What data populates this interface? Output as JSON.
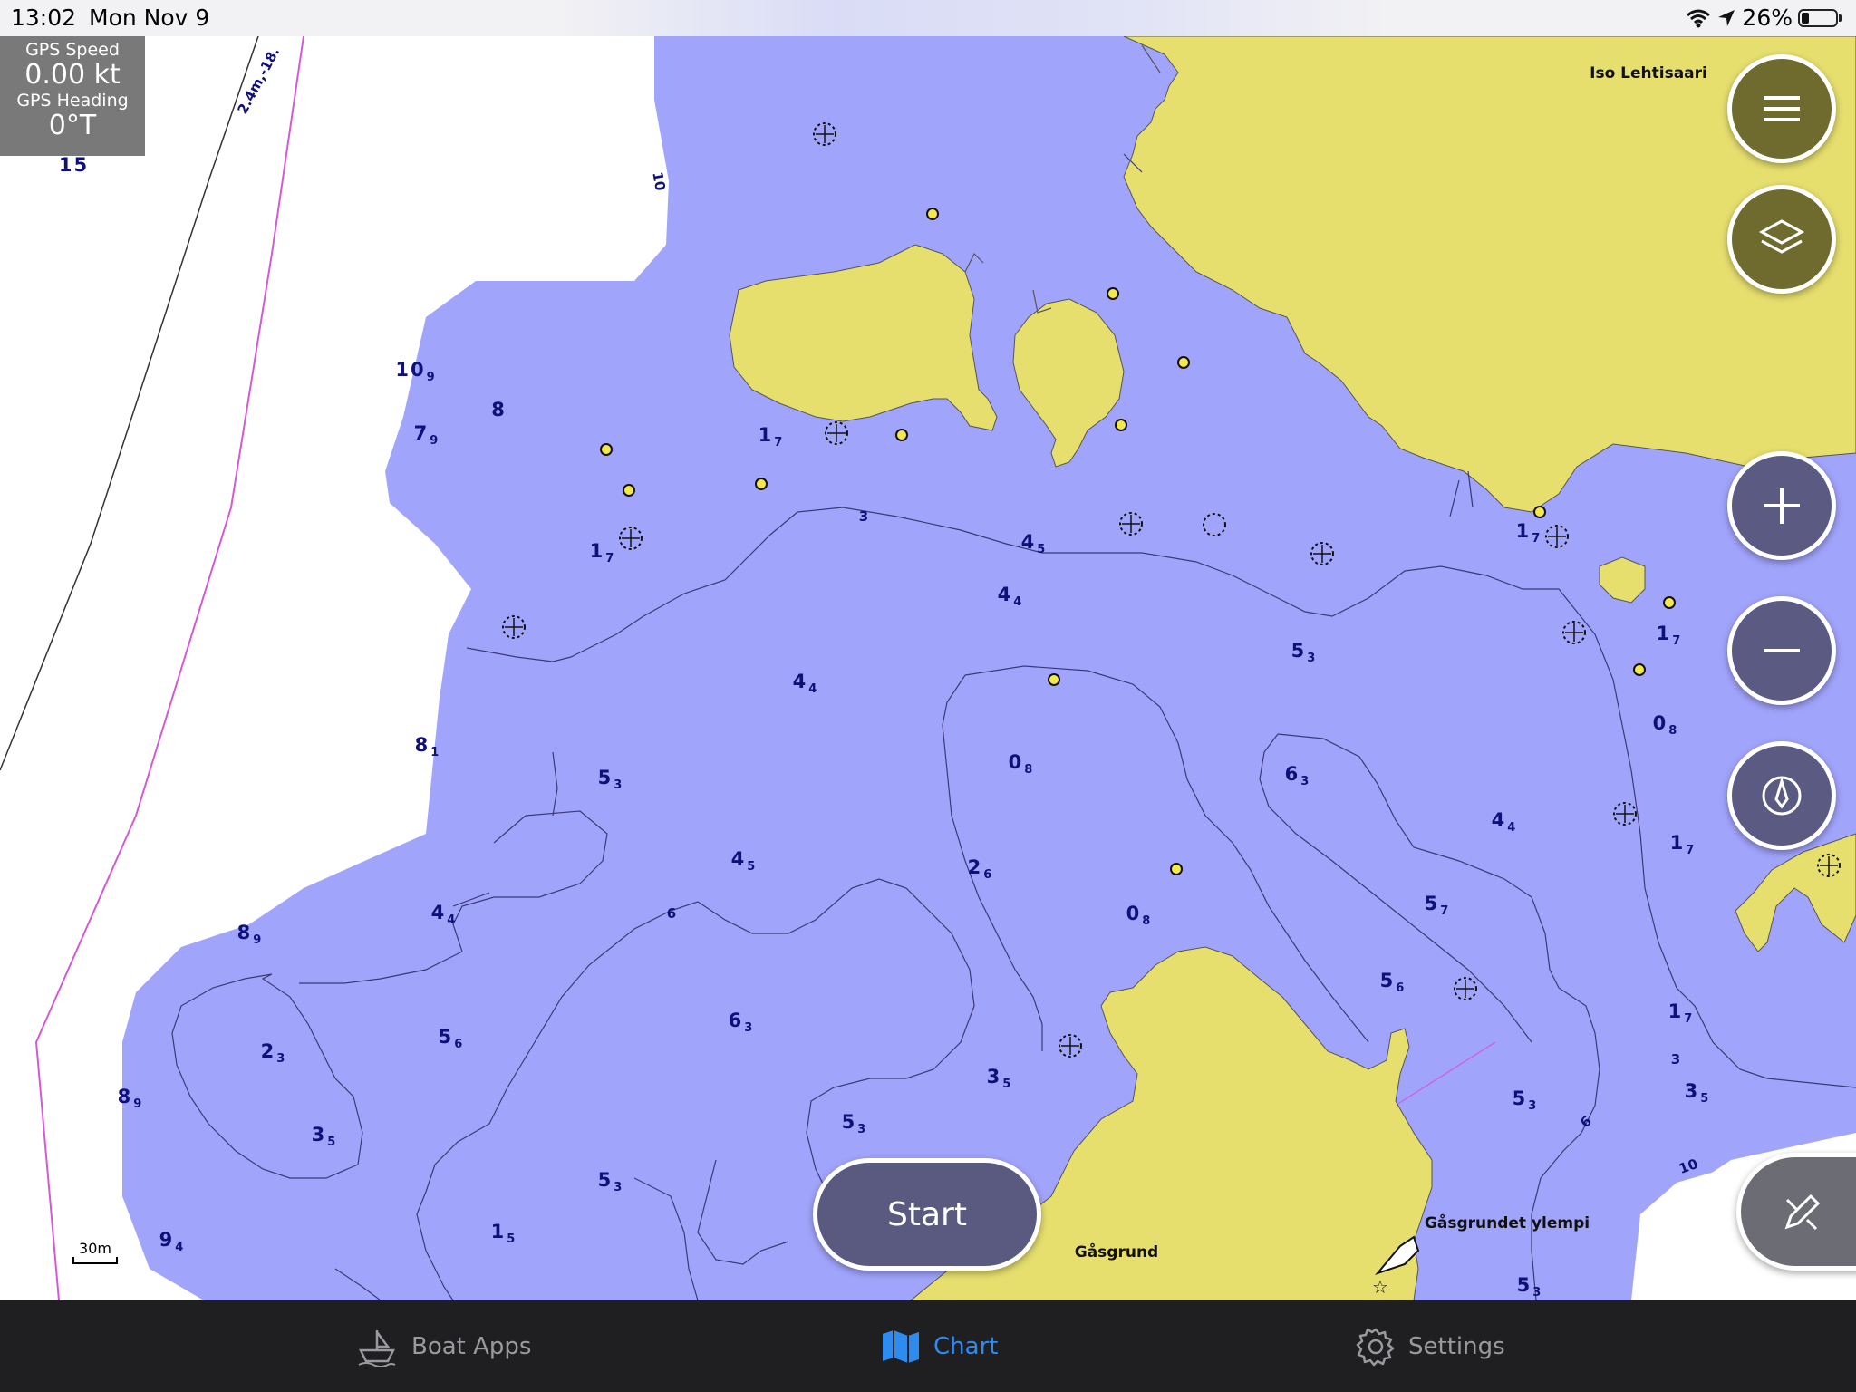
{
  "status_bar": {
    "time": "13:02",
    "date": "Mon Nov 9",
    "battery": "26%",
    "icons": [
      "wifi-icon",
      "location-arrow-icon",
      "battery-icon"
    ]
  },
  "gps_panel": {
    "speed_label": "GPS Speed",
    "speed_value": "0.00 kt",
    "heading_label": "GPS Heading",
    "heading_value": "0°T"
  },
  "map": {
    "colors": {
      "land": "#e6df6e",
      "water": "#a1a4fb",
      "deep_water": "#ffffff",
      "depth_text": "#10107a",
      "safety_line": "#d45ad4"
    },
    "places": [
      "Iso Lehtisaari",
      "Gåsgrund",
      "Gåsgrundet ylempi"
    ],
    "route_label": "2.4m,-18.",
    "contour_labels": [
      "10",
      "3",
      "6",
      "3",
      "6",
      "10"
    ],
    "soundings": [
      {
        "main": "15",
        "sub": ""
      },
      {
        "main": "10",
        "sub": "9"
      },
      {
        "main": "8",
        "sub": ""
      },
      {
        "main": "7",
        "sub": "9"
      },
      {
        "main": "1",
        "sub": "7"
      },
      {
        "main": "1",
        "sub": "7"
      },
      {
        "main": "4",
        "sub": "5"
      },
      {
        "main": "4",
        "sub": "4"
      },
      {
        "main": "4",
        "sub": "4"
      },
      {
        "main": "5",
        "sub": "3"
      },
      {
        "main": "1",
        "sub": "7"
      },
      {
        "main": "1",
        "sub": "7"
      },
      {
        "main": "0",
        "sub": "8"
      },
      {
        "main": "8",
        "sub": "1"
      },
      {
        "main": "5",
        "sub": "3"
      },
      {
        "main": "0",
        "sub": "8"
      },
      {
        "main": "6",
        "sub": "3"
      },
      {
        "main": "4",
        "sub": "4"
      },
      {
        "main": "4",
        "sub": "5"
      },
      {
        "main": "2",
        "sub": "6"
      },
      {
        "main": "1",
        "sub": "7"
      },
      {
        "main": "4",
        "sub": "4"
      },
      {
        "main": "0",
        "sub": "8"
      },
      {
        "main": "5",
        "sub": "7"
      },
      {
        "main": "8",
        "sub": "9"
      },
      {
        "main": "5",
        "sub": "6"
      },
      {
        "main": "1",
        "sub": "7"
      },
      {
        "main": "2",
        "sub": "3"
      },
      {
        "main": "5",
        "sub": "6"
      },
      {
        "main": "6",
        "sub": "3"
      },
      {
        "main": "3",
        "sub": "5"
      },
      {
        "main": "3",
        "sub": "5"
      },
      {
        "main": "8",
        "sub": "9"
      },
      {
        "main": "5",
        "sub": "3"
      },
      {
        "main": "3",
        "sub": "5"
      },
      {
        "main": "5",
        "sub": "3"
      },
      {
        "main": "5",
        "sub": "3"
      },
      {
        "main": "9",
        "sub": "4"
      },
      {
        "main": "1",
        "sub": "5"
      },
      {
        "main": "5",
        "sub": "3"
      }
    ],
    "scale": "30m"
  },
  "controls": {
    "start_label": "Start",
    "buttons": [
      "menu-icon",
      "layers-icon",
      "zoom-in-icon",
      "zoom-out-icon",
      "compass-icon",
      "edit-route-icon"
    ]
  },
  "tab_bar": {
    "tabs": [
      {
        "label": "Boat Apps",
        "icon": "boat-icon"
      },
      {
        "label": "Chart",
        "icon": "map-icon"
      },
      {
        "label": "Settings",
        "icon": "gear-icon"
      }
    ],
    "active": "Chart"
  }
}
